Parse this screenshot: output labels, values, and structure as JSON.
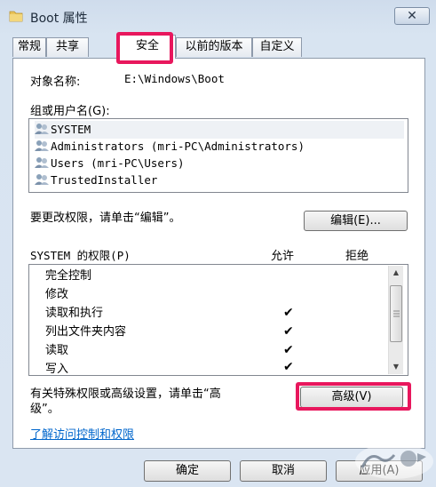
{
  "window": {
    "title": "Boot 属性",
    "close_glyph": "✕"
  },
  "tabs": [
    {
      "label": "常规"
    },
    {
      "label": "共享"
    },
    {
      "label": "安全"
    },
    {
      "label": "以前的版本"
    },
    {
      "label": "自定义"
    }
  ],
  "security": {
    "object_label": "对象名称:",
    "object_value": "E:\\Windows\\Boot",
    "group_label": "组或用户名(G):",
    "users": [
      {
        "name": "SYSTEM"
      },
      {
        "name": "Administrators (mri-PC\\Administrators)"
      },
      {
        "name": "Users (mri-PC\\Users)"
      },
      {
        "name": "TrustedInstaller"
      }
    ],
    "edit_hint": "要更改权限，请单击“编辑”。",
    "edit_button": "编辑(E)...",
    "perm_header": "SYSTEM 的权限(P)",
    "allow_header": "允许",
    "deny_header": "拒绝",
    "permissions": [
      {
        "name": "完全控制",
        "allow": false,
        "deny": false
      },
      {
        "name": "修改",
        "allow": false,
        "deny": false
      },
      {
        "name": "读取和执行",
        "allow": true,
        "deny": false
      },
      {
        "name": "列出文件夹内容",
        "allow": true,
        "deny": false
      },
      {
        "name": "读取",
        "allow": true,
        "deny": false
      },
      {
        "name": "写入",
        "allow": true,
        "deny": false
      }
    ],
    "check_glyph": "✔",
    "advanced_hint_line1": "有关特殊权限或高级设置，请单击“高",
    "advanced_hint_line2": "级”。",
    "advanced_button": "高级(V)",
    "learn_link": "了解访问控制和权限"
  },
  "footer": {
    "ok_button": "确定",
    "cancel_button": "取消",
    "apply_button": "应用(A)"
  },
  "colors": {
    "highlight": "#e8175d",
    "link": "#0066cc"
  }
}
